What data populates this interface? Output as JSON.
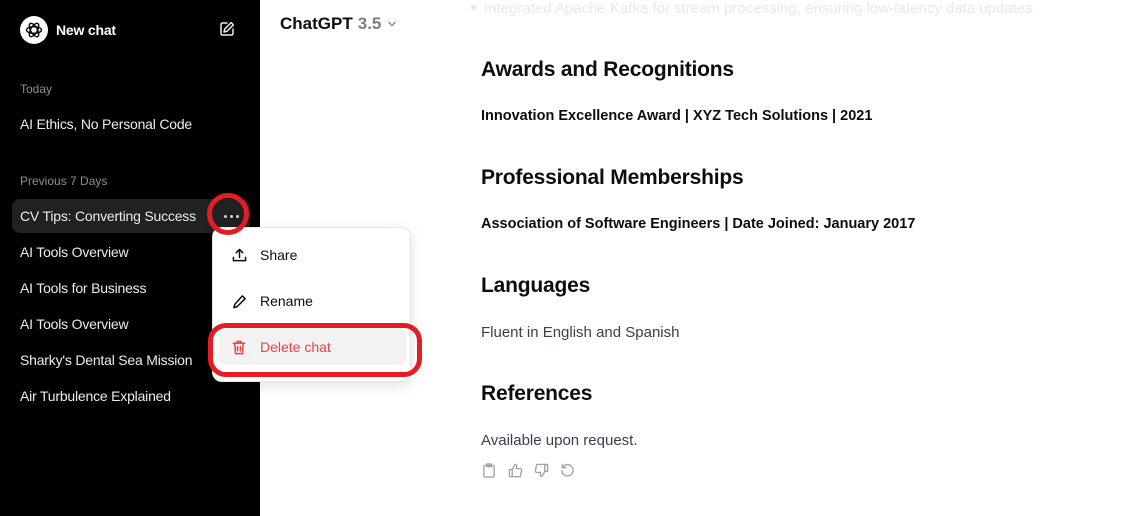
{
  "sidebar": {
    "new_chat_label": "New chat",
    "groups": [
      {
        "label": "Today",
        "items": [
          "AI Ethics, No Personal Code"
        ]
      },
      {
        "label": "Previous 7 Days",
        "items": [
          "CV Tips: Converting Success",
          "AI Tools Overview",
          "AI Tools for Business",
          "AI Tools Overview",
          "Sharky's Dental Sea Mission",
          "Air Turbulence Explained"
        ]
      }
    ],
    "active_item": "CV Tips: Converting Success"
  },
  "context_menu": {
    "items": [
      {
        "label": "Share",
        "icon": "share-icon"
      },
      {
        "label": "Rename",
        "icon": "pencil-icon"
      },
      {
        "label": "Delete chat",
        "icon": "trash-icon"
      }
    ]
  },
  "header": {
    "model_name": "ChatGPT",
    "model_version": "3.5"
  },
  "content": {
    "faded_bullet": "Integrated Apache Kafka for stream processing, ensuring low-latency data updates.",
    "sections": [
      {
        "heading": "Awards and Recognitions",
        "text": "Innovation Excellence Award | XYZ Tech Solutions | 2021",
        "bold": true
      },
      {
        "heading": "Professional Memberships",
        "text": "Association of Software Engineers | Date Joined: January 2017",
        "bold": true
      },
      {
        "heading": "Languages",
        "text": "Fluent in English and Spanish",
        "bold": false
      },
      {
        "heading": "References",
        "text": "Available upon request.",
        "bold": false
      }
    ],
    "actions": [
      "copy-icon",
      "thumbs-up-icon",
      "thumbs-down-icon",
      "regenerate-icon"
    ]
  },
  "colors": {
    "sidebar_bg": "#000000",
    "active_item_bg": "#212121",
    "danger": "#ef4146",
    "highlight_ring": "#e41d25"
  }
}
